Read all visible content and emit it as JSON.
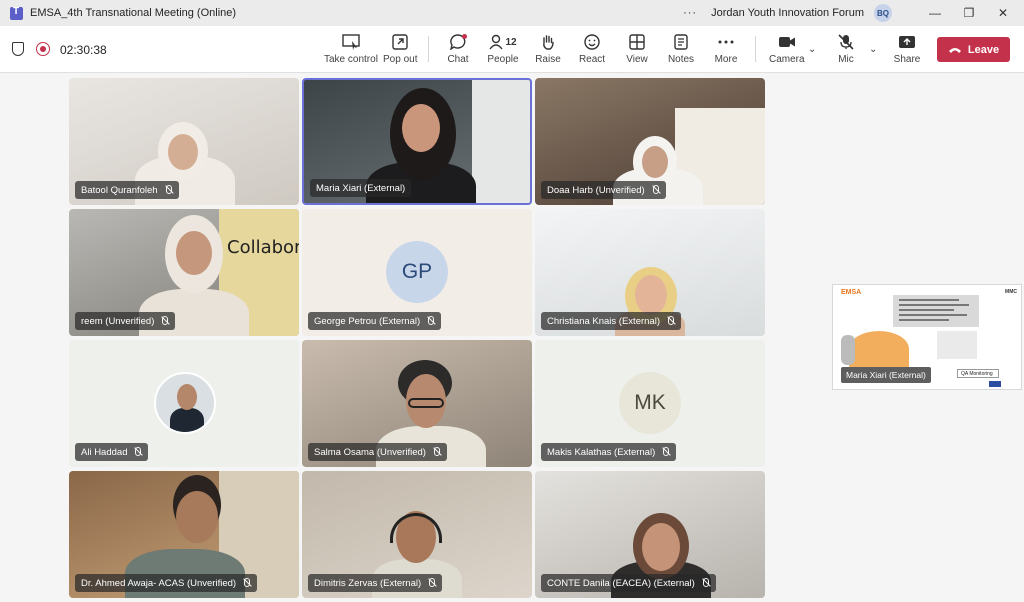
{
  "window": {
    "title": "EMSA_4th Transnational Meeting (Online)",
    "org": "Jordan Youth Innovation Forum",
    "user_initials": "BQ",
    "more": "···",
    "minimize": "—",
    "restore": "❐",
    "close": "✕"
  },
  "toolbar": {
    "timer": "02:30:38",
    "take_control": "Take control",
    "pop_out": "Pop out",
    "chat": "Chat",
    "people": "People",
    "people_count": "12",
    "raise": "Raise",
    "react": "React",
    "view": "View",
    "notes": "Notes",
    "more": "More",
    "camera": "Camera",
    "mic": "Mic",
    "share": "Share",
    "leave": "Leave"
  },
  "participants": [
    {
      "name": "Batool Quranfoleh"
    },
    {
      "name": "Maria Xiari (External)"
    },
    {
      "name": "Doaa Harb (Unverified)"
    },
    {
      "name": "reem (Unverified)"
    },
    {
      "name": "George Petrou (External)",
      "initials": "GP"
    },
    {
      "name": "Christiana Knais (External)"
    },
    {
      "name": "Ali Haddad"
    },
    {
      "name": "Salma Osama (Unverified)"
    },
    {
      "name": "Makis Kalathas (External)",
      "initials": "MK"
    },
    {
      "name": "Dr. Ahmed Awaja- ACAS (Unverified)"
    },
    {
      "name": "Dimitris Zervas (External)"
    },
    {
      "name": "CONTE Danila (EACEA) (External)"
    }
  ],
  "shared_screen": {
    "presenter": "Maria Xiari (External)",
    "logo": "EMSA",
    "org_logo": "MMC",
    "qa_label": "QA Monitoring"
  },
  "colors": {
    "accent": "#6b70d6",
    "leave": "#c4314b",
    "brand": "#5b5fc7"
  }
}
